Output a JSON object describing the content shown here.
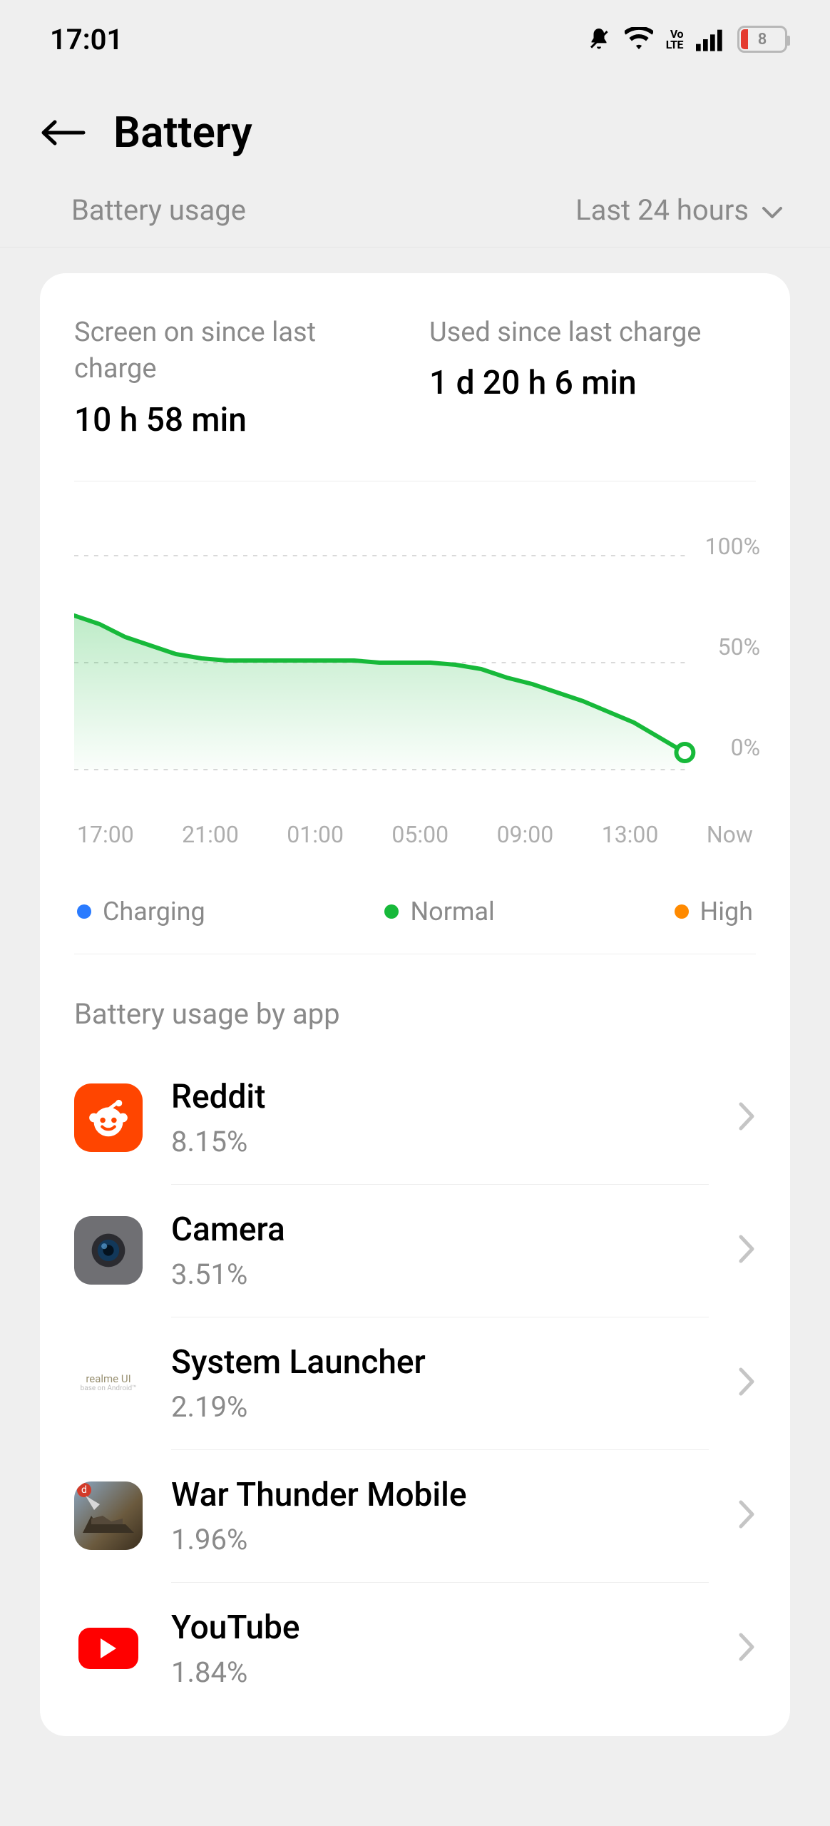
{
  "status": {
    "time": "17:01",
    "battery_percent": "8"
  },
  "header": {
    "title": "Battery"
  },
  "section": {
    "label": "Battery usage",
    "range": "Last 24 hours"
  },
  "stats": {
    "screen_on_label": "Screen on since last charge",
    "screen_on_value": "10 h 58 min",
    "used_since_label": "Used since last charge",
    "used_since_value": "1 d 20 h 6 min"
  },
  "chart_data": {
    "type": "area",
    "title": "",
    "xlabel": "",
    "ylabel": "",
    "ylim": [
      0,
      100
    ],
    "x_ticks": [
      "17:00",
      "21:00",
      "01:00",
      "05:00",
      "09:00",
      "13:00",
      "Now"
    ],
    "y_ticks": [
      "100%",
      "50%",
      "0%"
    ],
    "series": [
      {
        "name": "Battery level",
        "color": "#17b93a",
        "x": [
          "17:00",
          "18:00",
          "19:00",
          "20:00",
          "21:00",
          "22:00",
          "23:00",
          "00:00",
          "01:00",
          "02:00",
          "03:00",
          "04:00",
          "05:00",
          "06:00",
          "07:00",
          "08:00",
          "09:00",
          "10:00",
          "11:00",
          "12:00",
          "13:00",
          "14:00",
          "15:00",
          "16:00",
          "Now"
        ],
        "values": [
          72,
          68,
          62,
          58,
          54,
          52,
          51,
          51,
          51,
          51,
          51,
          51,
          50,
          50,
          50,
          49,
          47,
          43,
          40,
          36,
          32,
          27,
          22,
          15,
          8
        ]
      }
    ],
    "legend": [
      {
        "name": "Charging",
        "color": "#2a7bff"
      },
      {
        "name": "Normal",
        "color": "#17b93a"
      },
      {
        "name": "High",
        "color": "#ff8a00"
      }
    ]
  },
  "by_app": {
    "title": "Battery usage by app",
    "apps": [
      {
        "name": "Reddit",
        "percent": "8.15%"
      },
      {
        "name": "Camera",
        "percent": "3.51%"
      },
      {
        "name": "System Launcher",
        "percent": "2.19%"
      },
      {
        "name": "War Thunder Mobile",
        "percent": "1.96%"
      },
      {
        "name": "YouTube",
        "percent": "1.84%"
      }
    ]
  },
  "icon_labels": {
    "realme_line1": "realme UI",
    "realme_line2": "base on Android™"
  }
}
